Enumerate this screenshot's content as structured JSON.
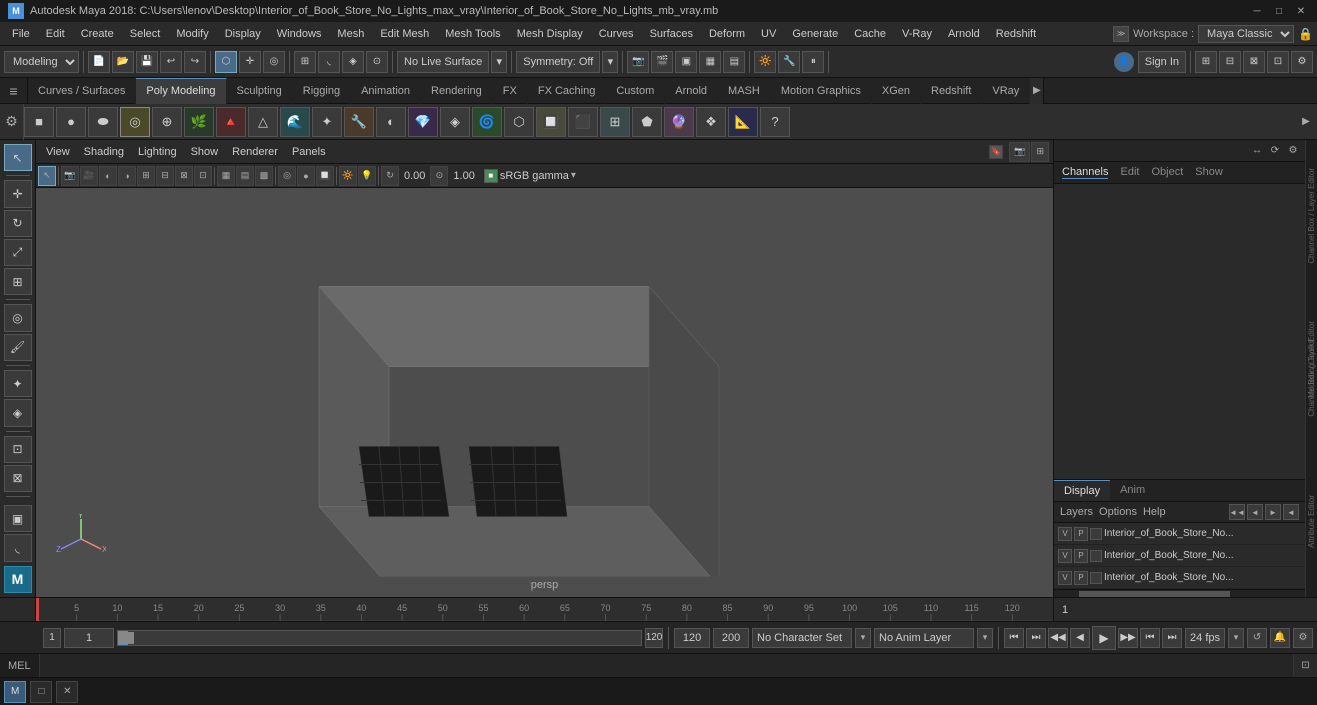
{
  "titleBar": {
    "icon": "M",
    "text": "Autodesk Maya 2018: C:\\Users\\lenov\\Desktop\\Interior_of_Book_Store_No_Lights_max_vray\\Interior_of_Book_Store_No_Lights_mb_vray.mb",
    "controls": [
      "─",
      "□",
      "✕"
    ]
  },
  "menuBar": {
    "items": [
      "File",
      "Edit",
      "Create",
      "Select",
      "Modify",
      "Display",
      "Windows",
      "Mesh",
      "Edit Mesh",
      "Mesh Tools",
      "Mesh Display",
      "Curves",
      "Surfaces",
      "Deform",
      "UV",
      "Generate",
      "Cache",
      "V-Ray",
      "Arnold",
      "Redshift"
    ],
    "workspaceLabel": "Workspace :",
    "workspaceValue": "Maya Classic",
    "lockIcon": "🔒"
  },
  "toolbarRow": {
    "modeLabel": "Modeling",
    "noLiveSurface": "No Live Surface",
    "symmetryOff": "Symmetry: Off",
    "signIn": "Sign In"
  },
  "tabBar": {
    "tabs": [
      "Curves / Surfaces",
      "Poly Modeling",
      "Sculpting",
      "Rigging",
      "Animation",
      "Rendering",
      "FX",
      "FX Caching",
      "Custom",
      "Arnold",
      "MASH",
      "Motion Graphics",
      "XGen",
      "Redshift",
      "VRay"
    ]
  },
  "viewport": {
    "menuItems": [
      "View",
      "Shading",
      "Lighting",
      "Show",
      "Renderer",
      "Panels"
    ],
    "perspLabel": "persp",
    "cameraValue1": "0.00",
    "cameraValue2": "1.00",
    "colorSpace": "sRGB gamma"
  },
  "rightPanel": {
    "headerItems": [
      "Channels",
      "Edit",
      "Object",
      "Show"
    ],
    "tabs": [
      "Display",
      "Anim"
    ],
    "layerMenuItems": [
      "Layers",
      "Options",
      "Help"
    ],
    "layerButtons": [
      "◄◄",
      "◄",
      "►",
      "◄"
    ],
    "layers": [
      {
        "v": "V",
        "p": "P",
        "name": "Interior_of_Book_Store_No..."
      },
      {
        "v": "V",
        "p": "P",
        "name": "Interior_of_Book_Store_No..."
      },
      {
        "v": "V",
        "p": "P",
        "name": "Interior_of_Book_Store_No..."
      }
    ],
    "sideLabels": [
      "Channel Box / Layer Editor",
      "Modelling Toolkit",
      "Attribute Editor"
    ]
  },
  "timeline": {
    "startFrame": "1",
    "endFrame": "120",
    "currentFrame": "1",
    "ticks": [
      5,
      10,
      15,
      20,
      25,
      30,
      35,
      40,
      45,
      50,
      55,
      60,
      65,
      70,
      75,
      80,
      85,
      90,
      95,
      100,
      105,
      110,
      115,
      120
    ],
    "playhead": 0
  },
  "bottomControls": {
    "frameStart": "1",
    "frameField": "1",
    "frameSliderValue": "1",
    "frameEnd": "120",
    "frameEnd2": "120",
    "frameEnd3": "200",
    "noCharacterSet": "No Character Set",
    "noAnimLayer": "No Anim Layer",
    "fps": "24 fps",
    "playButtons": [
      "⏮",
      "⏭",
      "◀◀",
      "◀",
      "▶",
      "▶▶",
      "⏮",
      "⏭"
    ]
  },
  "melBar": {
    "label": "MEL",
    "placeholder": ""
  },
  "taskbar": {
    "items": [
      "M",
      "□",
      "✕"
    ]
  },
  "colors": {
    "accent": "#5a8fc0",
    "bg_dark": "#1a1a1a",
    "bg_mid": "#2a2a2a",
    "bg_light": "#3a3a3a",
    "viewport_bg": "#4a4a4a",
    "text_dim": "#888",
    "text_normal": "#ccc",
    "text_bright": "#ddd"
  }
}
